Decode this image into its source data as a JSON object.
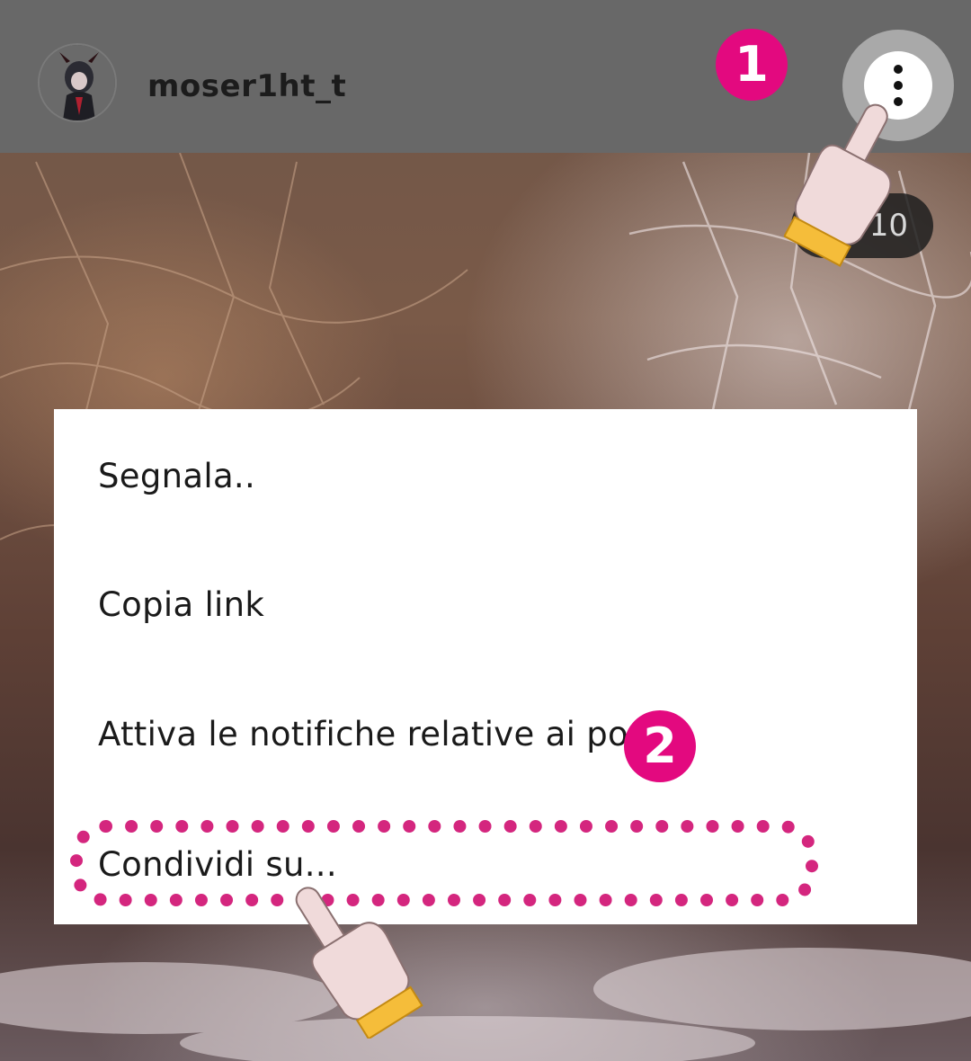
{
  "header": {
    "username": "moser1ht_t",
    "avatar_icon": "avatar-icon",
    "more_icon": "more-vertical-icon"
  },
  "counter": {
    "label": "/10"
  },
  "menu": {
    "items": [
      {
        "label": "Segnala.."
      },
      {
        "label": "Copia link"
      },
      {
        "label": "Attiva le notifiche relative ai post"
      },
      {
        "label": "Condividi su..."
      }
    ]
  },
  "annotations": {
    "step1": "1",
    "step2": "2",
    "accent_color": "#e3097f",
    "hand_icon": "pointing-hand-icon"
  }
}
